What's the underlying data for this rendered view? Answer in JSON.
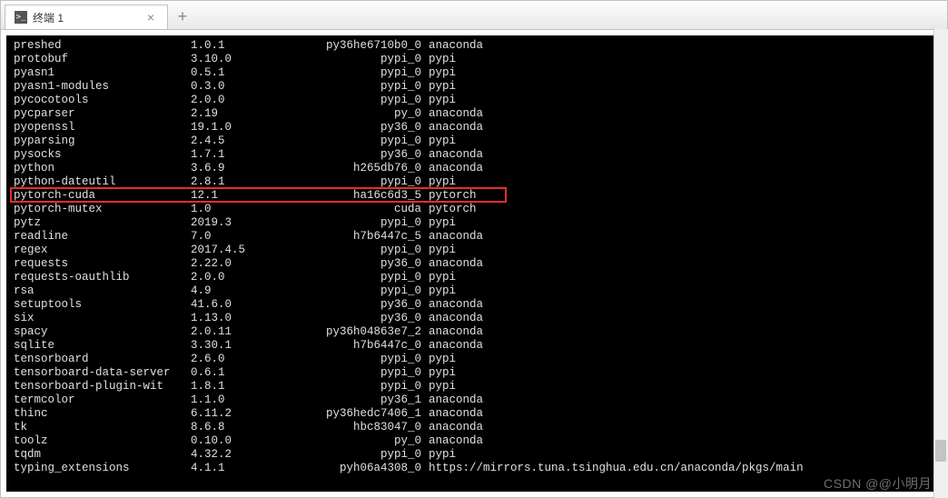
{
  "tab": {
    "title": "终端 1",
    "icon_text": ">_",
    "close_glyph": "×",
    "new_tab_glyph": "+"
  },
  "highlight_row_index": 10,
  "watermark": "CSDN @@小明月",
  "packages": [
    {
      "name": "preshed",
      "version": "1.0.1",
      "build": "py36he6710b0_0",
      "channel": "anaconda"
    },
    {
      "name": "protobuf",
      "version": "3.10.0",
      "build": "pypi_0",
      "channel": "pypi"
    },
    {
      "name": "pyasn1",
      "version": "0.5.1",
      "build": "pypi_0",
      "channel": "pypi"
    },
    {
      "name": "pyasn1-modules",
      "version": "0.3.0",
      "build": "pypi_0",
      "channel": "pypi"
    },
    {
      "name": "pycocotools",
      "version": "2.0.0",
      "build": "pypi_0",
      "channel": "pypi"
    },
    {
      "name": "pycparser",
      "version": "2.19",
      "build": "py_0",
      "channel": "anaconda"
    },
    {
      "name": "pyopenssl",
      "version": "19.1.0",
      "build": "py36_0",
      "channel": "anaconda"
    },
    {
      "name": "pyparsing",
      "version": "2.4.5",
      "build": "pypi_0",
      "channel": "pypi"
    },
    {
      "name": "pysocks",
      "version": "1.7.1",
      "build": "py36_0",
      "channel": "anaconda"
    },
    {
      "name": "python",
      "version": "3.6.9",
      "build": "h265db76_0",
      "channel": "anaconda"
    },
    {
      "name": "python-dateutil",
      "version": "2.8.1",
      "build": "pypi_0",
      "channel": "pypi"
    },
    {
      "name": "pytorch-cuda",
      "version": "12.1",
      "build": "ha16c6d3_5",
      "channel": "pytorch"
    },
    {
      "name": "pytorch-mutex",
      "version": "1.0",
      "build": "cuda",
      "channel": "pytorch"
    },
    {
      "name": "pytz",
      "version": "2019.3",
      "build": "pypi_0",
      "channel": "pypi"
    },
    {
      "name": "readline",
      "version": "7.0",
      "build": "h7b6447c_5",
      "channel": "anaconda"
    },
    {
      "name": "regex",
      "version": "2017.4.5",
      "build": "pypi_0",
      "channel": "pypi"
    },
    {
      "name": "requests",
      "version": "2.22.0",
      "build": "py36_0",
      "channel": "anaconda"
    },
    {
      "name": "requests-oauthlib",
      "version": "2.0.0",
      "build": "pypi_0",
      "channel": "pypi"
    },
    {
      "name": "rsa",
      "version": "4.9",
      "build": "pypi_0",
      "channel": "pypi"
    },
    {
      "name": "setuptools",
      "version": "41.6.0",
      "build": "py36_0",
      "channel": "anaconda"
    },
    {
      "name": "six",
      "version": "1.13.0",
      "build": "py36_0",
      "channel": "anaconda"
    },
    {
      "name": "spacy",
      "version": "2.0.11",
      "build": "py36h04863e7_2",
      "channel": "anaconda"
    },
    {
      "name": "sqlite",
      "version": "3.30.1",
      "build": "h7b6447c_0",
      "channel": "anaconda"
    },
    {
      "name": "tensorboard",
      "version": "2.6.0",
      "build": "pypi_0",
      "channel": "pypi"
    },
    {
      "name": "tensorboard-data-server",
      "version": "0.6.1",
      "build": "pypi_0",
      "channel": "pypi"
    },
    {
      "name": "tensorboard-plugin-wit",
      "version": "1.8.1",
      "build": "pypi_0",
      "channel": "pypi"
    },
    {
      "name": "termcolor",
      "version": "1.1.0",
      "build": "py36_1",
      "channel": "anaconda"
    },
    {
      "name": "thinc",
      "version": "6.11.2",
      "build": "py36hedc7406_1",
      "channel": "anaconda"
    },
    {
      "name": "tk",
      "version": "8.6.8",
      "build": "hbc83047_0",
      "channel": "anaconda"
    },
    {
      "name": "toolz",
      "version": "0.10.0",
      "build": "py_0",
      "channel": "anaconda"
    },
    {
      "name": "tqdm",
      "version": "4.32.2",
      "build": "pypi_0",
      "channel": "pypi"
    },
    {
      "name": "typing_extensions",
      "version": "4.1.1",
      "build": "pyh06a4308_0",
      "channel": "https://mirrors.tuna.tsinghua.edu.cn/anaconda/pkgs/main"
    }
  ]
}
